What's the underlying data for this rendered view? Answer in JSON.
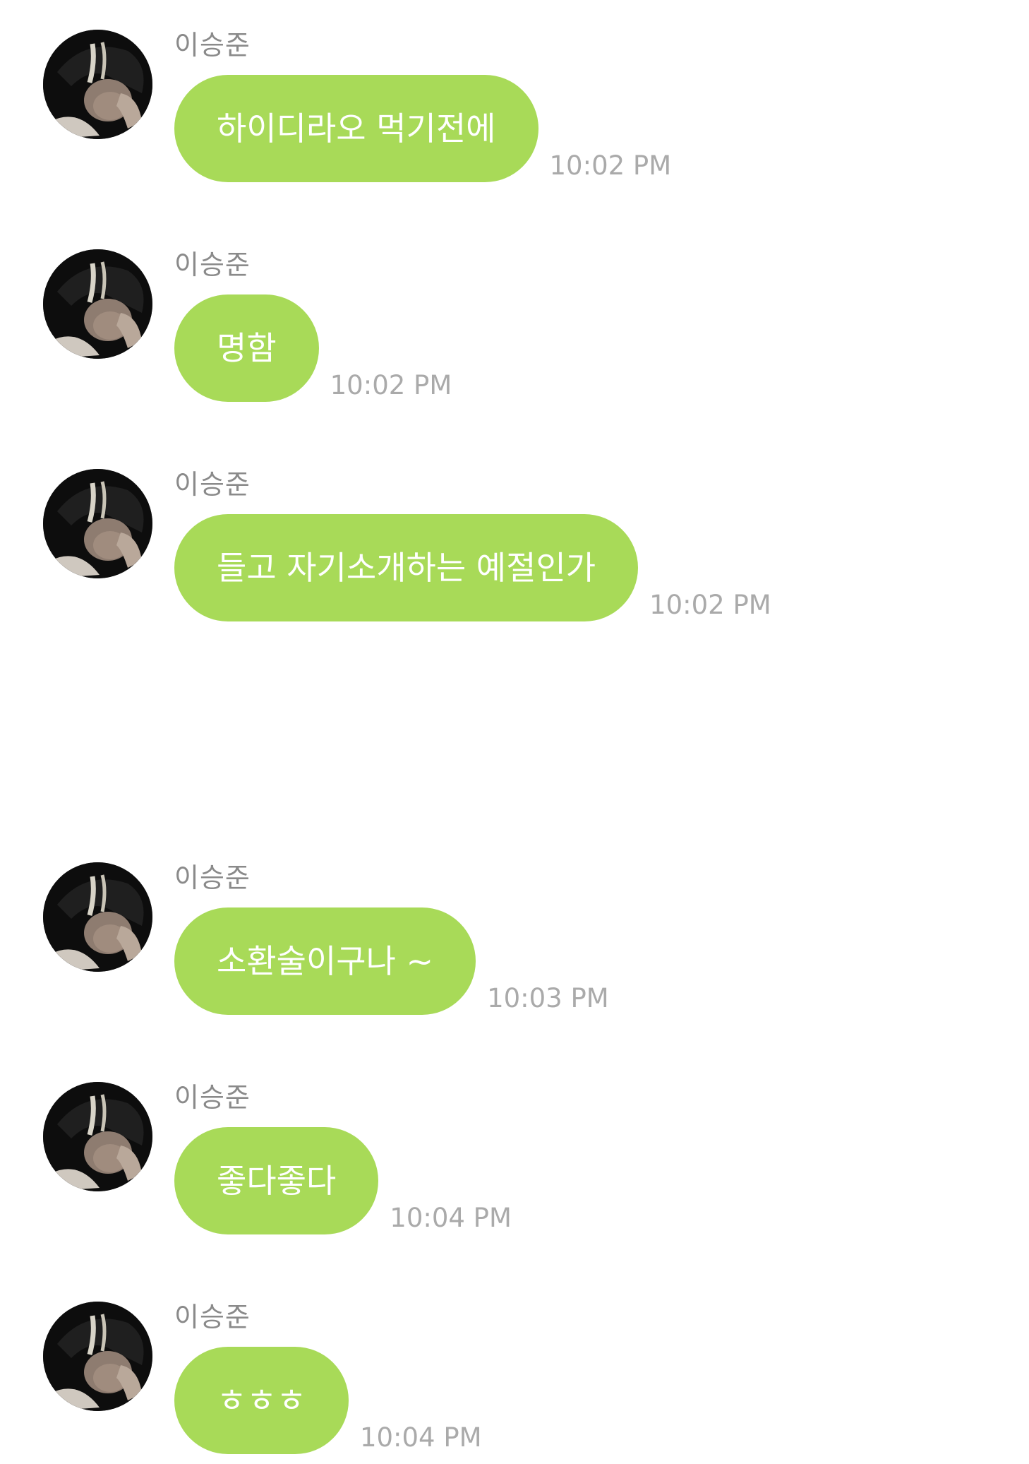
{
  "messages": [
    {
      "sender": "이승준",
      "text": "하이디라오 먹기전에",
      "time": "10:02 PM"
    },
    {
      "sender": "이승준",
      "text": "명함",
      "time": "10:02 PM"
    },
    {
      "sender": "이승준",
      "text": "들고 자기소개하는 예절인가",
      "time": "10:02 PM"
    },
    {
      "sender": "이승준",
      "text": "소환술이구나 ~",
      "time": "10:03 PM"
    },
    {
      "sender": "이승준",
      "text": "좋다좋다",
      "time": "10:04 PM"
    },
    {
      "sender": "이승준",
      "text": "ㅎㅎㅎ",
      "time": "10:04 PM"
    }
  ],
  "colors": {
    "bubble": "#a8da58",
    "bubble_text": "#ffffff",
    "sender_text": "#8a8a8a",
    "time_text": "#aaaaaa",
    "background": "#ffffff"
  }
}
